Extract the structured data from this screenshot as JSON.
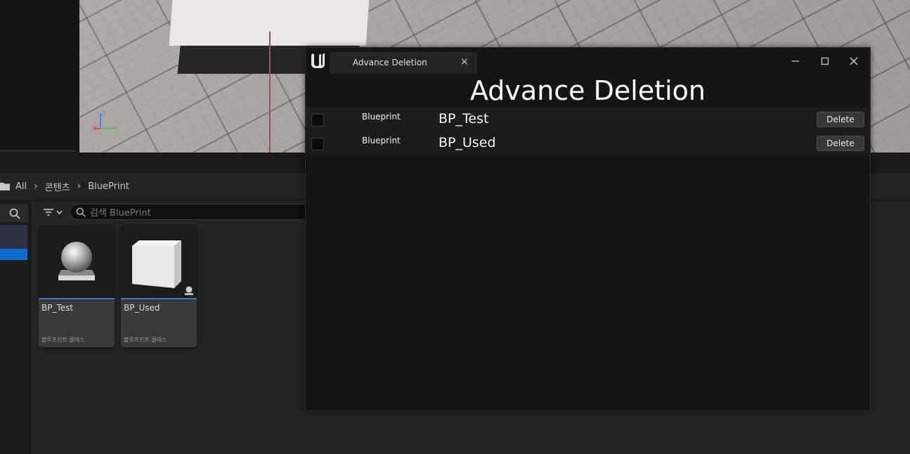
{
  "viewport": {
    "axis_labels": {
      "z": "Z",
      "x": "X",
      "y": "Y"
    }
  },
  "content_browser": {
    "breadcrumb": [
      "All",
      "콘텐츠",
      "BluePrint"
    ],
    "search": {
      "placeholder": "검색 BluePrint"
    },
    "assets": [
      {
        "name": "BP_Test",
        "type_label": "블루프린트 클래스",
        "icon": "sphere-icon"
      },
      {
        "name": "BP_Used",
        "type_label": "블루프린트 클래스",
        "icon": "cube-icon"
      }
    ]
  },
  "window": {
    "tab_label": "Advance Deletion",
    "heading": "Advance Deletion",
    "rows": [
      {
        "type": "Blueprint",
        "name": "BP_Test",
        "button": "Delete"
      },
      {
        "type": "Blueprint",
        "name": "BP_Used",
        "button": "Delete"
      }
    ]
  },
  "colors": {
    "accent": "#3a78e0",
    "selection": "#0e6cd1",
    "window_bg": "#151515"
  }
}
